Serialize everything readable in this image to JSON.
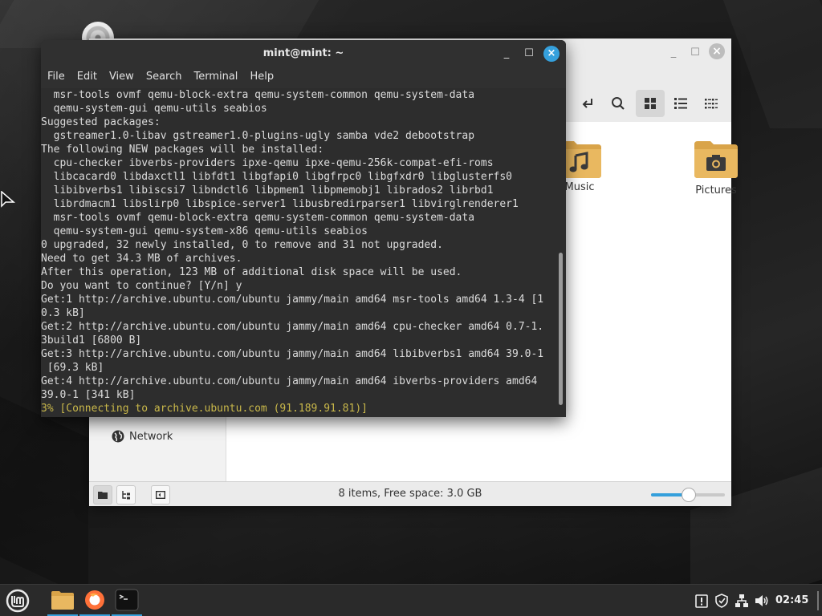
{
  "terminal": {
    "title": "mint@mint: ~",
    "menu": [
      "File",
      "Edit",
      "View",
      "Search",
      "Terminal",
      "Help"
    ],
    "lines": [
      "  msr-tools ovmf qemu-block-extra qemu-system-common qemu-system-data",
      "  qemu-system-gui qemu-utils seabios",
      "Suggested packages:",
      "  gstreamer1.0-libav gstreamer1.0-plugins-ugly samba vde2 debootstrap",
      "The following NEW packages will be installed:",
      "  cpu-checker ibverbs-providers ipxe-qemu ipxe-qemu-256k-compat-efi-roms",
      "  libcacard0 libdaxctl1 libfdt1 libgfapi0 libgfrpc0 libgfxdr0 libglusterfs0",
      "  libibverbs1 libiscsi7 libndctl6 libpmem1 libpmemobj1 librados2 librbd1",
      "  librdmacm1 libslirp0 libspice-server1 libusbredirparser1 libvirglrenderer1",
      "  msr-tools ovmf qemu-block-extra qemu-system-common qemu-system-data",
      "  qemu-system-gui qemu-system-x86 qemu-utils seabios",
      "0 upgraded, 32 newly installed, 0 to remove and 31 not upgraded.",
      "Need to get 34.3 MB of archives.",
      "After this operation, 123 MB of additional disk space will be used.",
      "Do you want to continue? [Y/n] y",
      "Get:1 http://archive.ubuntu.com/ubuntu jammy/main amd64 msr-tools amd64 1.3-4 [1",
      "0.3 kB]",
      "Get:2 http://archive.ubuntu.com/ubuntu jammy/main amd64 cpu-checker amd64 0.7-1.",
      "3build1 [6800 B]",
      "Get:3 http://archive.ubuntu.com/ubuntu jammy/main amd64 libibverbs1 amd64 39.0-1",
      " [69.3 kB]",
      "Get:4 http://archive.ubuntu.com/ubuntu jammy/main amd64 ibverbs-providers amd64",
      "39.0-1 [341 kB]"
    ],
    "progress_line": "3% [Connecting to archive.ubuntu.com (91.189.91.81)]"
  },
  "file_manager": {
    "sidebar": {
      "network_label": "Network"
    },
    "folders": [
      {
        "label": "Music",
        "icon": "music-note-icon"
      },
      {
        "label": "Pictures",
        "icon": "camera-icon"
      }
    ],
    "status_text": "8 items, Free space: 3.0 GB",
    "zoom_level": 0.5
  },
  "taskbar": {
    "clock": "02:45"
  },
  "colors": {
    "accent": "#35a0dc",
    "folder": "#e9b860",
    "terminal_bg": "#2d2d2d",
    "progress_text": "#c9b84a"
  }
}
